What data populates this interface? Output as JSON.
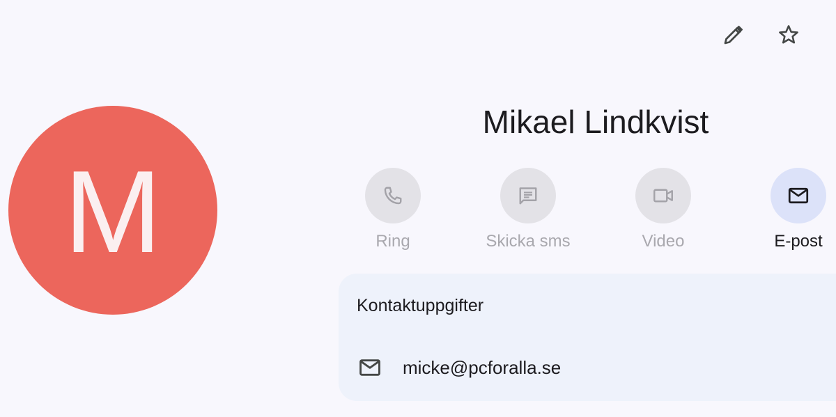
{
  "header": {
    "edit_icon": "pencil-icon",
    "favorite_icon": "star-outline-icon"
  },
  "contact": {
    "initial": "M",
    "name": "Mikael Lindkvist",
    "avatar_color": "#ec665c"
  },
  "actions": [
    {
      "label": "Ring",
      "icon": "phone-icon",
      "enabled": false
    },
    {
      "label": "Skicka sms",
      "icon": "message-icon",
      "enabled": false
    },
    {
      "label": "Video",
      "icon": "video-icon",
      "enabled": false
    },
    {
      "label": "E-post",
      "icon": "mail-icon",
      "enabled": true
    }
  ],
  "details": {
    "title": "Kontaktuppgifter",
    "email_icon": "mail-icon",
    "email": "micke@pcforalla.se"
  },
  "colors": {
    "background": "#f8f7fd",
    "card": "#eef2fb",
    "active_action": "#dce2f9",
    "inactive_action": "#e3e2e7"
  }
}
